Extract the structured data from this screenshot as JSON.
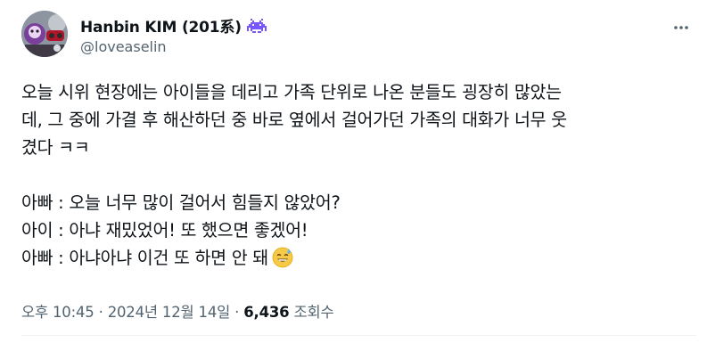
{
  "author": {
    "display_name": "Hanbin KIM (201系)",
    "handle": "@loveaselin",
    "badge_icon": "space-invader-icon",
    "badge_color": "#7856ff"
  },
  "more_icon": "more-options-icon",
  "tweet": {
    "lines": [
      "오늘 시위 현장에는 아이들을 데리고 가족 단위로 나온 분들도 굉장히 많았는",
      "데, 그 중에 가결 후 해산하던 중 바로 옆에서 걸어가던 가족의 대화가 너무 웃",
      "겼다 ㅋㅋ"
    ],
    "dialog": [
      "아빠 : 오늘 너무 많이 걸어서 힘들지 않았어?",
      "아이 : 아냐 재밌었어! 또 했으면 좋겠어!",
      "아빠 : 아냐아냐 이건 또 하면 안 돼"
    ],
    "emoji": "grinning-face-with-sweat-icon"
  },
  "meta": {
    "time": "오후 10:45",
    "sep1": " · ",
    "date": "2024년 12월 14일",
    "sep2": " · ",
    "views_count": "6,436",
    "views_label": " 조회수"
  },
  "colors": {
    "text": "#0f1419",
    "secondary": "#536471",
    "divider": "#eff3f4"
  }
}
